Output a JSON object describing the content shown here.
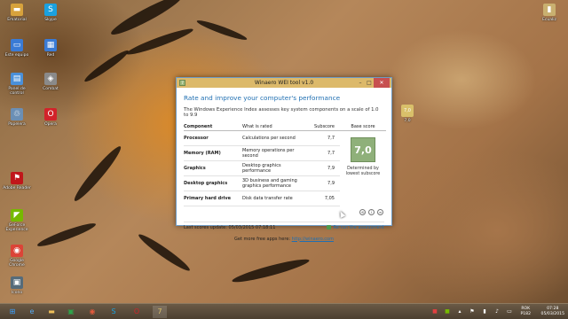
{
  "desktop": {
    "icons_left": [
      {
        "label": "Ematorial",
        "icon": "folder-icon",
        "color": "#d7a23c",
        "glyph": "▬"
      },
      {
        "label": "Skype",
        "icon": "skype-icon",
        "color": "#1aa1e0",
        "glyph": "S"
      },
      {
        "label": "Este equipo",
        "icon": "computer-icon",
        "color": "#3a7bd5",
        "glyph": "▭"
      },
      {
        "label": "Red",
        "icon": "network-icon",
        "color": "#3a7bd5",
        "glyph": "▦"
      },
      {
        "label": "Panel de control",
        "icon": "control-panel-icon",
        "color": "#4a90d9",
        "glyph": "▤"
      },
      {
        "label": "Combat",
        "icon": "app-icon",
        "color": "#8a8a8a",
        "glyph": "◈"
      },
      {
        "label": "Papelera",
        "icon": "recycle-bin-icon",
        "color": "#6b8fb5",
        "glyph": "♲"
      },
      {
        "label": "Opera",
        "icon": "opera-icon",
        "color": "#d2232a",
        "glyph": "O"
      },
      {
        "label": "Adobe Reader",
        "icon": "pdf-icon",
        "color": "#c0161a",
        "glyph": "⚑"
      },
      {
        "label": "GeForce Experience",
        "icon": "geforce-icon",
        "color": "#76b900",
        "glyph": "◤"
      },
      {
        "label": "Google Chrome",
        "icon": "chrome-icon",
        "color": "#db4437",
        "glyph": "◉"
      },
      {
        "label": "Icono",
        "icon": "shortcut-icon",
        "color": "#556b7a",
        "glyph": "▣"
      }
    ],
    "icons_right": [
      {
        "label": "Ecualiz",
        "icon": "book-icon",
        "color": "#c9b070",
        "glyph": "▮"
      },
      {
        "label": "7,0",
        "icon": "wei-tool-icon",
        "color": "#d9c06a",
        "glyph": "7,0"
      }
    ]
  },
  "window": {
    "title": "Winaero WEI tool v1.0",
    "app_icon_text": "7",
    "heading": "Rate and improve your computer's performance",
    "description": "The Windows Experience Index assesses key system components on a scale of 1.0 to 9.9",
    "columns": {
      "component": "Component",
      "rated": "What is rated",
      "subscore": "Subscore",
      "base": "Base score"
    },
    "rows": [
      {
        "component": "Processor",
        "rated": "Calculations per second",
        "subscore": "7,7"
      },
      {
        "component": "Memory (RAM)",
        "rated": "Memory operations per second",
        "subscore": "7,7"
      },
      {
        "component": "Graphics",
        "rated": "Desktop graphics performance",
        "subscore": "7,9"
      },
      {
        "component": "Desktop graphics",
        "rated": "3D business and gaming graphics performance",
        "subscore": "7,9"
      },
      {
        "component": "Primary hard drive",
        "rated": "Disk data transfer rate",
        "subscore": "7,05"
      }
    ],
    "base_score": "7,0",
    "base_note": "Determined by lowest subscore",
    "last_update": "Last scores update: 05/03/2015 07:18:11",
    "rerun_label": "Re-run the assessment",
    "free_apps_prefix": "Get more free apps here:",
    "free_apps_link": "http://winaero.com",
    "accent_color": "#1f6fb2",
    "score_color": "#8fb07a"
  },
  "taskbar": {
    "language_top": "ROK",
    "language_bottom": "P182",
    "time": "07:28",
    "date": "05/03/2015"
  }
}
